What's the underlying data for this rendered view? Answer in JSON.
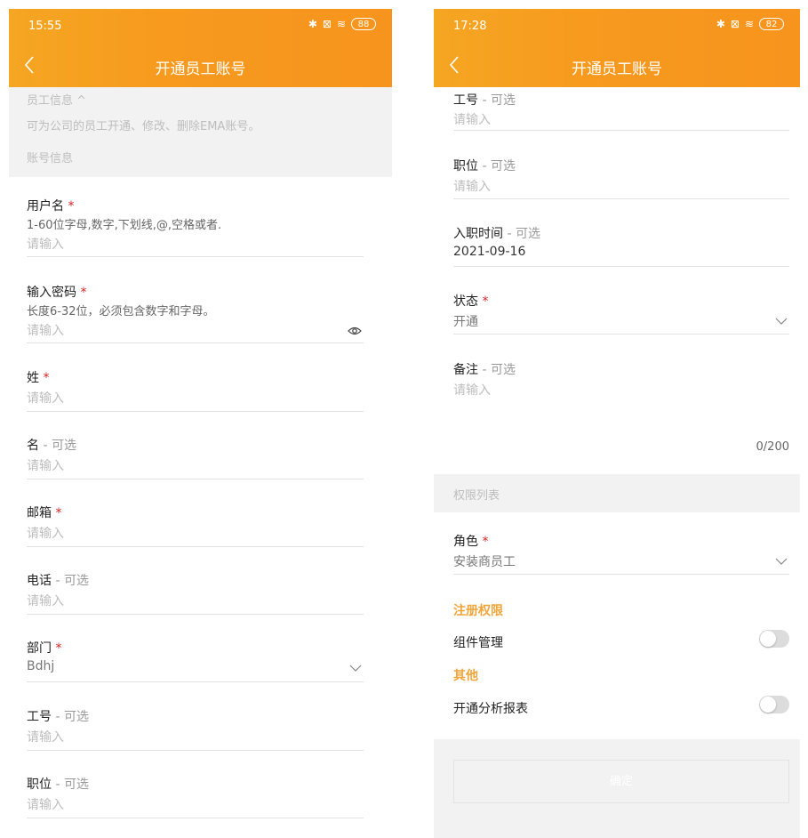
{
  "left": {
    "status": {
      "time": "15:55",
      "battery": "88"
    },
    "title": "开通员工账号",
    "info": {
      "section_title": "员工信息 ^",
      "description": "可为公司的员工开通、修改、删除EMA账号。",
      "account_section": "账号信息"
    },
    "fields": {
      "username": {
        "label": "用户名",
        "hint": "1-60位字母,数字,下划线,@,空格或者.",
        "placeholder": "请输入"
      },
      "password": {
        "label": "输入密码",
        "hint": "长度6-32位，必须包含数字和字母。",
        "placeholder": "请输入"
      },
      "last_name": {
        "label": "姓",
        "placeholder": "请输入"
      },
      "first_name": {
        "label": "名",
        "optional": " - 可选",
        "placeholder": "请输入"
      },
      "email": {
        "label": "邮箱",
        "placeholder": "请输入"
      },
      "phone": {
        "label": "电话",
        "optional": " - 可选",
        "placeholder": "请输入"
      },
      "department": {
        "label": "部门",
        "value": "Bdhj"
      },
      "employee_no": {
        "label": "工号",
        "optional": " - 可选",
        "placeholder": "请输入"
      },
      "position": {
        "label": "职位",
        "optional": " - 可选",
        "placeholder": "请输入"
      }
    },
    "required_mark": "*"
  },
  "right": {
    "status": {
      "time": "17:28",
      "battery": "82"
    },
    "title": "开通员工账号",
    "fields": {
      "employee_no": {
        "label": "工号",
        "optional": " - 可选",
        "placeholder": "请输入"
      },
      "position": {
        "label": "职位",
        "optional": " - 可选",
        "placeholder": "请输入"
      },
      "hire_date": {
        "label": "入职时间",
        "optional": " - 可选",
        "value": "2021-09-16"
      },
      "status": {
        "label": "状态",
        "value": "开通"
      },
      "remark": {
        "label": "备注",
        "optional": " - 可选",
        "placeholder": "请输入",
        "counter": "0/200"
      },
      "role": {
        "label": "角色",
        "value": "安装商员工"
      }
    },
    "permissions_section": "权限列表",
    "registration_permissions": {
      "heading": "注册权限",
      "items": [
        {
          "label": "组件管理",
          "enabled": false
        }
      ]
    },
    "other": {
      "heading": "其他",
      "items": [
        {
          "label": "开通分析报表",
          "enabled": false
        }
      ]
    },
    "confirm_label": "确定",
    "required_mark": "*"
  },
  "colors": {
    "brand_orange": "#f7941d",
    "accent_text": "#f0a53a",
    "required": "#e02020"
  },
  "icons": [
    "back-arrow-icon",
    "bluetooth-icon",
    "sim-icon",
    "wifi-icon",
    "battery-icon",
    "eye-icon",
    "chevron-down-icon"
  ]
}
